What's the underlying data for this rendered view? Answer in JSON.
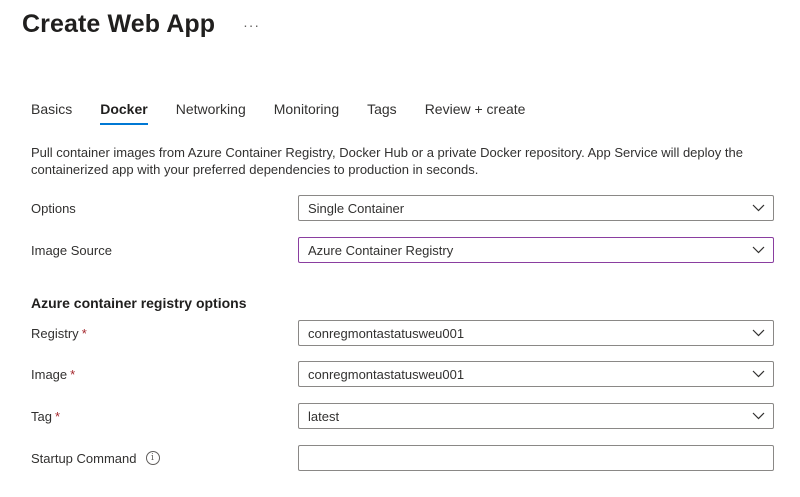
{
  "page": {
    "title": "Create Web App",
    "more": "···"
  },
  "tabs": [
    {
      "label": "Basics"
    },
    {
      "label": "Docker"
    },
    {
      "label": "Networking"
    },
    {
      "label": "Monitoring"
    },
    {
      "label": "Tags"
    },
    {
      "label": "Review + create"
    }
  ],
  "active_tab": "Docker",
  "description": "Pull container images from Azure Container Registry, Docker Hub or a private Docker repository. App Service will deploy the containerized app with your preferred dependencies to production in seconds.",
  "fields": {
    "options": {
      "label": "Options",
      "value": "Single Container"
    },
    "image_source": {
      "label": "Image Source",
      "value": "Azure Container Registry"
    },
    "registry": {
      "label": "Registry",
      "required": "*",
      "value": "conregmontastatusweu001"
    },
    "image": {
      "label": "Image",
      "required": "*",
      "value": "conregmontastatusweu001"
    },
    "tag": {
      "label": "Tag",
      "required": "*",
      "value": "latest"
    },
    "startup_command": {
      "label": "Startup Command",
      "info_icon": "i",
      "value": ""
    }
  },
  "section_heading": "Azure container registry options",
  "colors": {
    "accent": "#0078d4",
    "focus_border": "#8a3ea0",
    "required": "#a4262c"
  },
  "icons": {
    "dropdown": "chevron-down-icon",
    "info": "info-icon",
    "more": "more-icon"
  }
}
